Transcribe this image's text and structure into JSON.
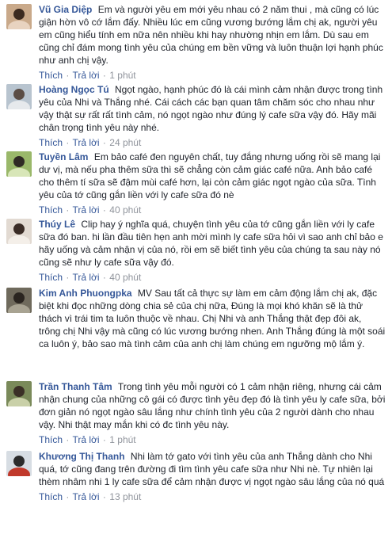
{
  "actions": {
    "like": "Thích",
    "reply": "Trả lời",
    "separator": "·"
  },
  "comments": [
    {
      "author": "Vũ Gia Diệp",
      "text": "Em và người yêu em mới yêu nhau có 2 năm thui , mà cũng có lúc giận hờn vô cớ lắm đấy. Nhiều lúc em cũng vương bướng lắm chị ak, người yêu em cũng hiểu tính em nữa nên nhiều khi hay nhường nhịn em lắm. Dù sau em cũng chỉ đám mong tình yêu của chúng em bền vững và luôn thuận lợi hạnh phúc như anh chị vậy.",
      "time": "1 phút",
      "avatar": {
        "bg": "#c9a98a",
        "fg": "#3b2a20",
        "accent": "#e8d3c0"
      }
    },
    {
      "author": "Hoàng Ngọc Tú",
      "text": "Ngọt ngào, hạnh phúc đó là cái mình cảm nhận được trong tình yêu của Nhi và Thắng nhé. Cái cách các bạn quan tâm chăm sóc cho nhau như vậy thật sự rất rất tình cảm, nó ngọt ngào như đúng lý cafe sữa vậy đó. Hãy mãi chân trọng tình yêu này nhé.",
      "time": "24 phút",
      "avatar": {
        "bg": "#b8c4cf",
        "fg": "#5b4d45",
        "accent": "#e6e9ec"
      }
    },
    {
      "author": "Tuyền Lâm",
      "text": "Em bảo café đen nguyên chất, tuy đắng nhưng uống rồi sẽ mang lại dư vị, mà nếu pha thêm sữa thì sẽ chẳng còn cảm giác café nữa. Anh bảo café cho thêm tí sữa sẽ đậm mùi café hơn, lại còn cảm giác ngọt ngào của sữa. Tình yêu của tớ cũng gắn liền với ly cafe sữa đó nè",
      "time": "40 phút",
      "avatar": {
        "bg": "#9ab86a",
        "fg": "#2f2a24",
        "accent": "#d8e6b8"
      }
    },
    {
      "author": "Thúy Lê",
      "text": "Clip hay ý nghĩa quá, chuyện tình yêu của tớ cũng gắn liền với ly cafe sữa đó ban. hi lần đầu tiên hẹn anh mời mình ly cafe sữa hỏi vì sao anh chỉ bảo e hãy uống và cảm nhận vị của nó, rồi em sẽ biết tình yêu của chúng ta sau này nó cũng sẽ như ly cafe sữa vậy đó.",
      "time": "40 phút",
      "avatar": {
        "bg": "#e2dad2",
        "fg": "#3a2c26",
        "accent": "#f4efe9"
      }
    },
    {
      "author": "Kim Anh Phuongpka",
      "text": "MV Sau tất cả thực sự làm em cảm động lắm chị ak, đặc biệt khi đọc những dòng chia sẻ của chị nữa, Đúng là mọi khó khăn sẽ là thử thách vì trái tim ta luôn thuộc về nhau. Chị Nhi và anh Thắng thật đẹp đôi ak, trông chị Nhi vậy mà cũng có lúc vương bướng nhen. Anh Thắng đúng là một soái ca luôn ý, bảo sao mà tình cảm của anh chị làm chúng em ngưỡng mộ lắm ý.",
      "time": "",
      "avatar": {
        "bg": "#6f6a5c",
        "fg": "#2a2520",
        "accent": "#a8a392"
      }
    },
    {
      "author": "Trần Thanh Tâm",
      "text": "Trong tình yêu mỗi người có 1 cảm nhận riêng, nhưng cái cảm nhận chung của những cô gái có được tình yêu đẹp đó là tình yêu ly cafe sữa, bởi đơn giản nó ngọt ngào sâu lắng như chính tình yêu của 2 người dành cho nhau vậy. Nhi thật may mắn khi có đc tình yêu này.",
      "time": "1 phút",
      "avatar": {
        "bg": "#7a8a5a",
        "fg": "#3a2f26",
        "accent": "#c9d0a8"
      }
    },
    {
      "author": "Khương Thị Thanh",
      "text": "Nhi làm tớ gato với tình yêu của anh Thắng dành cho Nhi quá, tớ cũng đang trên đường đi tìm tình yêu cafe sữa như Nhi nè. Tự nhiên lại thèm nhâm nhi 1 ly cafe sữa để cảm nhận được vị ngọt ngào sâu lắng của nó quá",
      "time": "13 phút",
      "avatar": {
        "bg": "#d7dde3",
        "fg": "#2b2b2b",
        "accent": "#c0392b"
      }
    }
  ]
}
